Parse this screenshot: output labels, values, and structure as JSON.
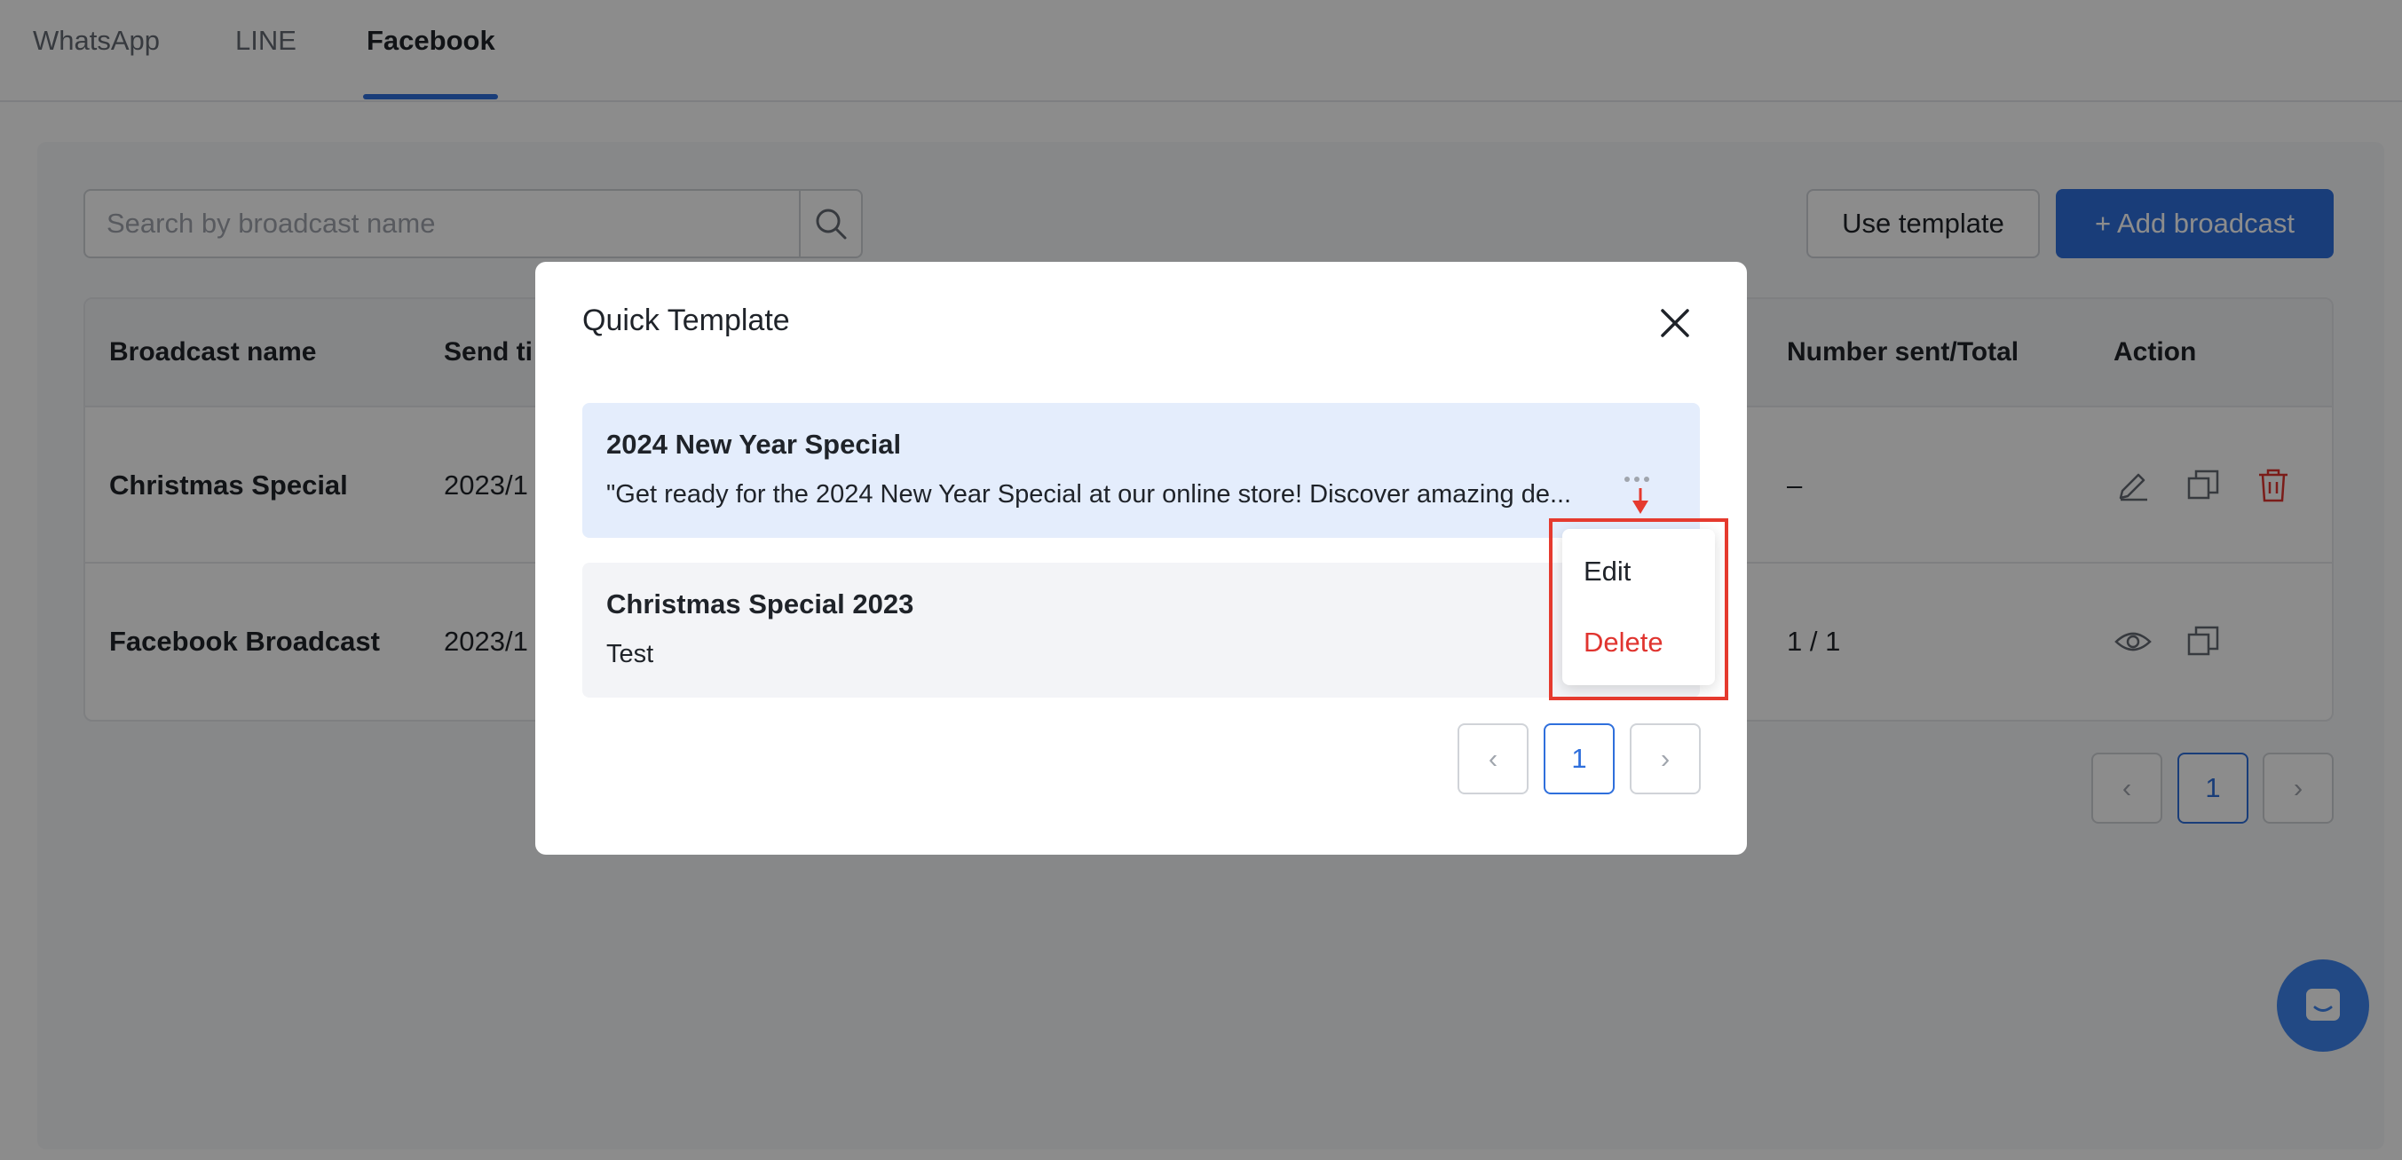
{
  "tabs": [
    {
      "label": "WhatsApp",
      "active": false
    },
    {
      "label": "LINE",
      "active": false
    },
    {
      "label": "Facebook",
      "active": true
    }
  ],
  "search": {
    "placeholder": "Search by broadcast name",
    "value": ""
  },
  "buttons": {
    "use_template": "Use template",
    "add_broadcast": "+ Add broadcast"
  },
  "table": {
    "headers": [
      "Broadcast name",
      "Send ti",
      "Number sent/Total",
      "Action"
    ],
    "rows": [
      {
        "name": "Christmas Special",
        "send_time": "2023/1",
        "sent_total": "–",
        "actions": [
          "edit-icon",
          "copy-icon",
          "trash-icon"
        ]
      },
      {
        "name": "Facebook Broadcast",
        "send_time": "2023/1",
        "sent_total": "1 / 1",
        "actions": [
          "eye-icon",
          "copy-icon"
        ]
      }
    ]
  },
  "pagination": {
    "current": "1",
    "prev": "‹",
    "next": "›"
  },
  "modal": {
    "title": "Quick Template",
    "templates": [
      {
        "name": "2024 New Year Special",
        "description": "\"Get ready for the 2024 New Year Special at our online store! Discover amazing de..."
      },
      {
        "name": "Christmas Special 2023",
        "description": "Test"
      }
    ],
    "menu": {
      "edit": "Edit",
      "delete": "Delete"
    },
    "pagination": {
      "current": "1",
      "prev": "‹",
      "next": "›"
    }
  },
  "colors": {
    "accent": "#2f6fdc",
    "danger": "#e0342f",
    "highlight": "#e53a2e",
    "chat_fab": "#3f85f0"
  }
}
